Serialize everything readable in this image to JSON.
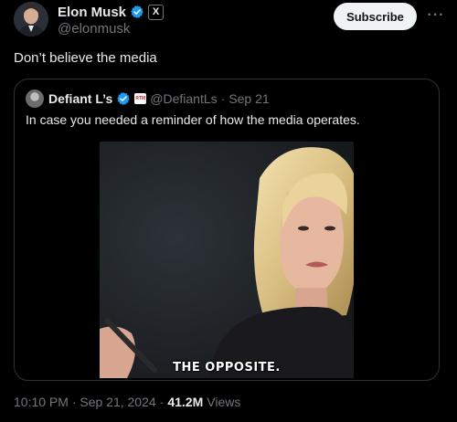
{
  "author": {
    "name": "Elon Musk",
    "handle": "@elonmusk",
    "x_badge": "X",
    "verified_color": "#1d9bf0"
  },
  "actions": {
    "subscribe_label": "Subscribe",
    "more_label": "···"
  },
  "tweet": {
    "text": "Don’t believe the media"
  },
  "quote": {
    "name": "Defiant L’s",
    "badge_label": "RTM",
    "handle": "@DefiantLs",
    "separator": "·",
    "date": "Sep 21",
    "text": "In case you needed a reminder of how the media operates.",
    "video_caption": "THE OPPOSITE."
  },
  "meta": {
    "time": "10:10 PM · Sep 21, 2024",
    "separator": "·",
    "views_count": "41.2M",
    "views_label": "Views"
  },
  "icons": {
    "verified": "verified-check-icon",
    "more": "more-horizontal-icon"
  }
}
